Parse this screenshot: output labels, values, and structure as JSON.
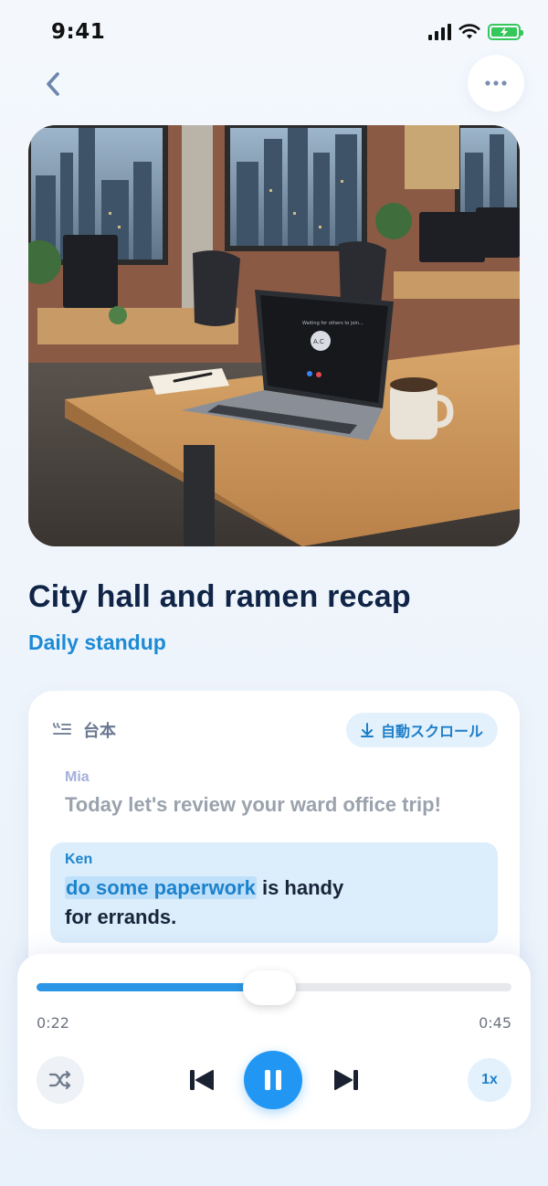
{
  "status_bar": {
    "time": "9:41",
    "icons": [
      "signal-icon",
      "wifi-icon",
      "battery-charging-icon"
    ]
  },
  "nav": {
    "back_icon": "chevron-left-icon",
    "more_icon": "more-horizontal-icon"
  },
  "cover": {
    "screen_text": "Waiting for others to join...",
    "avatar_initials": "A.C"
  },
  "lesson": {
    "title": "City hall and ramen recap",
    "subtitle": "Daily standup"
  },
  "transcript": {
    "header_label": "台本",
    "header_icon": "script-lines-icon",
    "autoscroll_label": "自動スクロール",
    "autoscroll_icon": "arrow-down-icon",
    "lines": [
      {
        "speaker": "Mia",
        "text": "Today let's review your ward office trip!"
      },
      {
        "speaker": "Ken",
        "highlight": "do some paperwork",
        "text_after": " is handy",
        "text_line2": "for errands."
      }
    ]
  },
  "player": {
    "current_time": "0:22",
    "total_time": "0:45",
    "progress": 0.49,
    "speed_label": "1x",
    "icons": [
      "shuffle-icon",
      "skip-previous-icon",
      "pause-icon",
      "skip-next-icon"
    ]
  },
  "colors": {
    "accent": "#2196f3",
    "title": "#0f2446",
    "subtitle": "#1d8ad6",
    "highlight_bg": "#dcedfb"
  }
}
